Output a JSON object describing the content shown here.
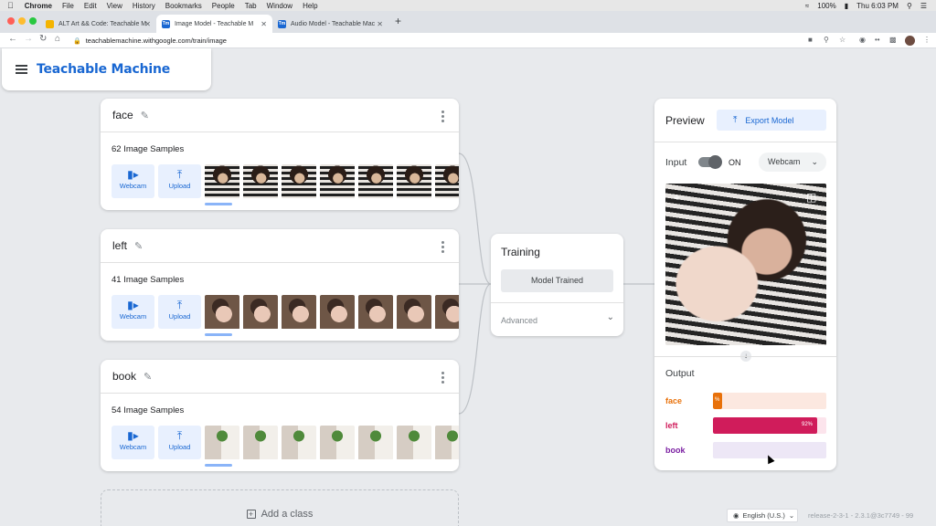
{
  "menubar": {
    "app": "Chrome",
    "items": [
      "File",
      "Edit",
      "View",
      "History",
      "Bookmarks",
      "People",
      "Tab",
      "Window",
      "Help"
    ],
    "battery": "100%",
    "clock": "Thu 6:03 PM"
  },
  "tabs": [
    {
      "title": "ALT Art && Code: Teachable M",
      "favicon_color": "#f4b400",
      "active": false
    },
    {
      "title": "Image Model - Teachable M",
      "favicon_color": "#1967d2",
      "favicon_text": "Tm",
      "active": true
    },
    {
      "title": "Audio Model - Teachable Mac",
      "favicon_color": "#1967d2",
      "favicon_text": "Tm",
      "active": false
    }
  ],
  "toolbar": {
    "url": "teachablemachine.withgoogle.com/train/image"
  },
  "brand": {
    "title": "Teachable Machine",
    "color": "#1967d2"
  },
  "classes": [
    {
      "name": "face",
      "samples": "62 Image Samples",
      "webcam_label": "Webcam",
      "upload_label": "Upload"
    },
    {
      "name": "left",
      "samples": "41 Image Samples",
      "webcam_label": "Webcam",
      "upload_label": "Upload"
    },
    {
      "name": "book",
      "samples": "54 Image Samples",
      "webcam_label": "Webcam",
      "upload_label": "Upload"
    }
  ],
  "add_class": {
    "label": "Add a class"
  },
  "training": {
    "title": "Training",
    "status_button": "Model Trained",
    "advanced": "Advanced"
  },
  "preview": {
    "title": "Preview",
    "export_label": "Export Model",
    "input_label": "Input",
    "toggle_state": "ON",
    "source": "Webcam",
    "output_label": "Output",
    "outputs": [
      {
        "name": "face",
        "percent": 8,
        "label": "%",
        "color": "#e8710a",
        "track": "#fce8e0"
      },
      {
        "name": "left",
        "percent": 92,
        "label": "92%",
        "color": "#d01c5b",
        "track": "#fce4ec"
      },
      {
        "name": "book",
        "percent": 0,
        "label": "",
        "color": "#7b1fa2",
        "track": "#ede7f6"
      }
    ]
  },
  "footer": {
    "language": "English (U.S.)",
    "release": "release-2-3-1 - 2.3.1@3c7749 - 99"
  },
  "icons": {
    "webcam": "webcam-icon",
    "upload": "upload-icon",
    "pencil": "pencil-icon",
    "export": "export-icon",
    "flip": "flip-camera-icon",
    "crop": "crop-icon"
  }
}
